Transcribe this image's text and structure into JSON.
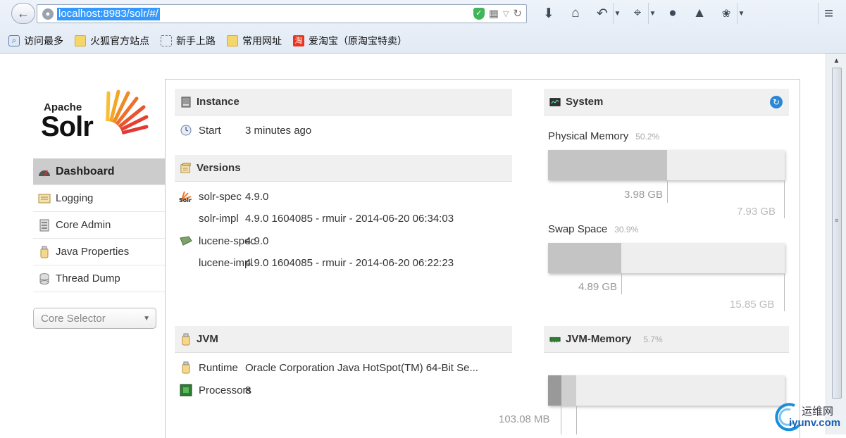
{
  "browser": {
    "url": "localhost:8983/solr/#/",
    "bookmarks": [
      {
        "label": "访问最多",
        "icon": "search-bookmark-icon"
      },
      {
        "label": "火狐官方站点",
        "icon": "folder-icon"
      },
      {
        "label": "新手上路",
        "icon": "dashed-page-icon"
      },
      {
        "label": "常用网址",
        "icon": "folder-icon"
      },
      {
        "label": "爱淘宝（原淘宝特卖）",
        "icon": "taobao-icon",
        "glyph": "淘"
      }
    ],
    "toolbar_icons": [
      "download-icon",
      "home-icon",
      "undo-icon",
      "crop-icon",
      "chat-icon",
      "user-icon",
      "bug-icon",
      "menu-icon"
    ]
  },
  "logo": {
    "apache": "Apache",
    "solr": "Solr"
  },
  "nav": {
    "items": [
      {
        "label": "Dashboard",
        "icon": "dashboard-icon",
        "active": true
      },
      {
        "label": "Logging",
        "icon": "logging-icon"
      },
      {
        "label": "Core Admin",
        "icon": "core-admin-icon"
      },
      {
        "label": "Java Properties",
        "icon": "java-icon"
      },
      {
        "label": "Thread Dump",
        "icon": "thread-dump-icon"
      }
    ],
    "core_selector": "Core Selector"
  },
  "instance": {
    "title": "Instance",
    "start_label": "Start",
    "start_value": "3 minutes ago"
  },
  "versions": {
    "title": "Versions",
    "rows": [
      {
        "label": "solr-spec",
        "value": "4.9.0"
      },
      {
        "label": "solr-impl",
        "value": "4.9.0 1604085 - rmuir - 2014-06-20 06:34:03"
      },
      {
        "label": "lucene-spec",
        "value": "4.9.0"
      },
      {
        "label": "lucene-impl",
        "value": "4.9.0 1604085 - rmuir - 2014-06-20 06:22:23"
      }
    ]
  },
  "jvm": {
    "title": "JVM",
    "runtime_label": "Runtime",
    "runtime_value": "Oracle Corporation Java HotSpot(TM) 64-Bit Se...",
    "processors_label": "Processors",
    "processors_value": "8"
  },
  "system": {
    "title": "System",
    "physical": {
      "label": "Physical Memory",
      "pct": "50.2%",
      "used": "3.98 GB",
      "total": "7.93 GB",
      "fraction": 0.502
    },
    "swap": {
      "label": "Swap Space",
      "pct": "30.9%",
      "used": "4.89 GB",
      "total": "15.85 GB",
      "fraction": 0.309
    }
  },
  "jvm_memory": {
    "title": "JVM-Memory",
    "pct": "5.7%",
    "used": "103.08 MB",
    "used_fraction": 0.057,
    "committed_fraction": 0.12
  },
  "watermark": {
    "cn": "运维网",
    "en": "iyunv.com"
  }
}
